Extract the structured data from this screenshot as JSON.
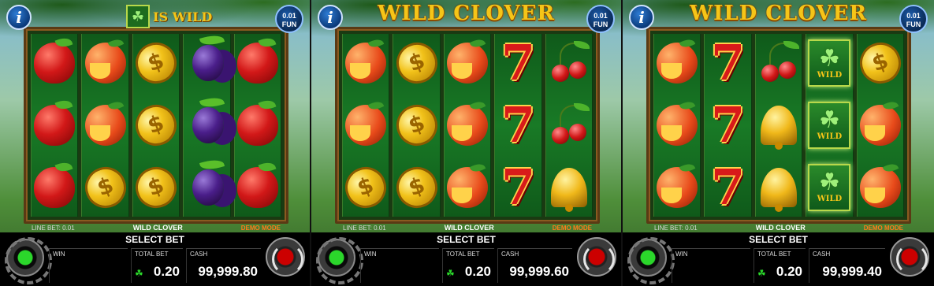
{
  "game": {
    "name": "WILD CLOVER",
    "logo": "WILD CLOVER",
    "info": "i",
    "fun_line1": "0.01",
    "fun_line2": "FUN",
    "is_wild": "IS WILD",
    "wild_label": "WILD",
    "line_bet": "LINE BET: 0.01",
    "demo_mode": "DEMO MODE",
    "select_bet": "SELECT BET",
    "win_label": "WIN",
    "total_bet_label": "TOTAL BET",
    "cash_label": "CASH"
  },
  "panels": [
    {
      "header": "wild-banner",
      "reels": [
        [
          "apple",
          "apple",
          "apple"
        ],
        [
          "peach",
          "peach",
          "coin"
        ],
        [
          "coin",
          "coin",
          "coin"
        ],
        [
          "plum",
          "plum",
          "plum"
        ],
        [
          "apple",
          "apple",
          "apple"
        ]
      ],
      "total_bet": "0.20",
      "cash": "99,999.80"
    },
    {
      "header": "logo",
      "reels": [
        [
          "peach",
          "peach",
          "coin"
        ],
        [
          "coin",
          "coin",
          "coin"
        ],
        [
          "peach",
          "peach",
          "peach"
        ],
        [
          "seven",
          "seven",
          "seven"
        ],
        [
          "cherry",
          "cherry",
          "bell"
        ]
      ],
      "total_bet": "0.20",
      "cash": "99,999.60"
    },
    {
      "header": "logo",
      "reels": [
        [
          "peach",
          "peach",
          "peach"
        ],
        [
          "seven",
          "seven",
          "seven"
        ],
        [
          "cherry",
          "bell",
          "bell"
        ],
        [
          "clover",
          "clover",
          "clover"
        ],
        [
          "coin",
          "peach",
          "peach"
        ]
      ],
      "total_bet": "0.20",
      "cash": "99,999.40"
    }
  ],
  "colors": {
    "logo_gold": "#f5c518",
    "demo_orange": "#ff7a1a",
    "reel_green": "#197a26",
    "gear_green": "#2bd72b",
    "spin_red": "#cc0000"
  }
}
